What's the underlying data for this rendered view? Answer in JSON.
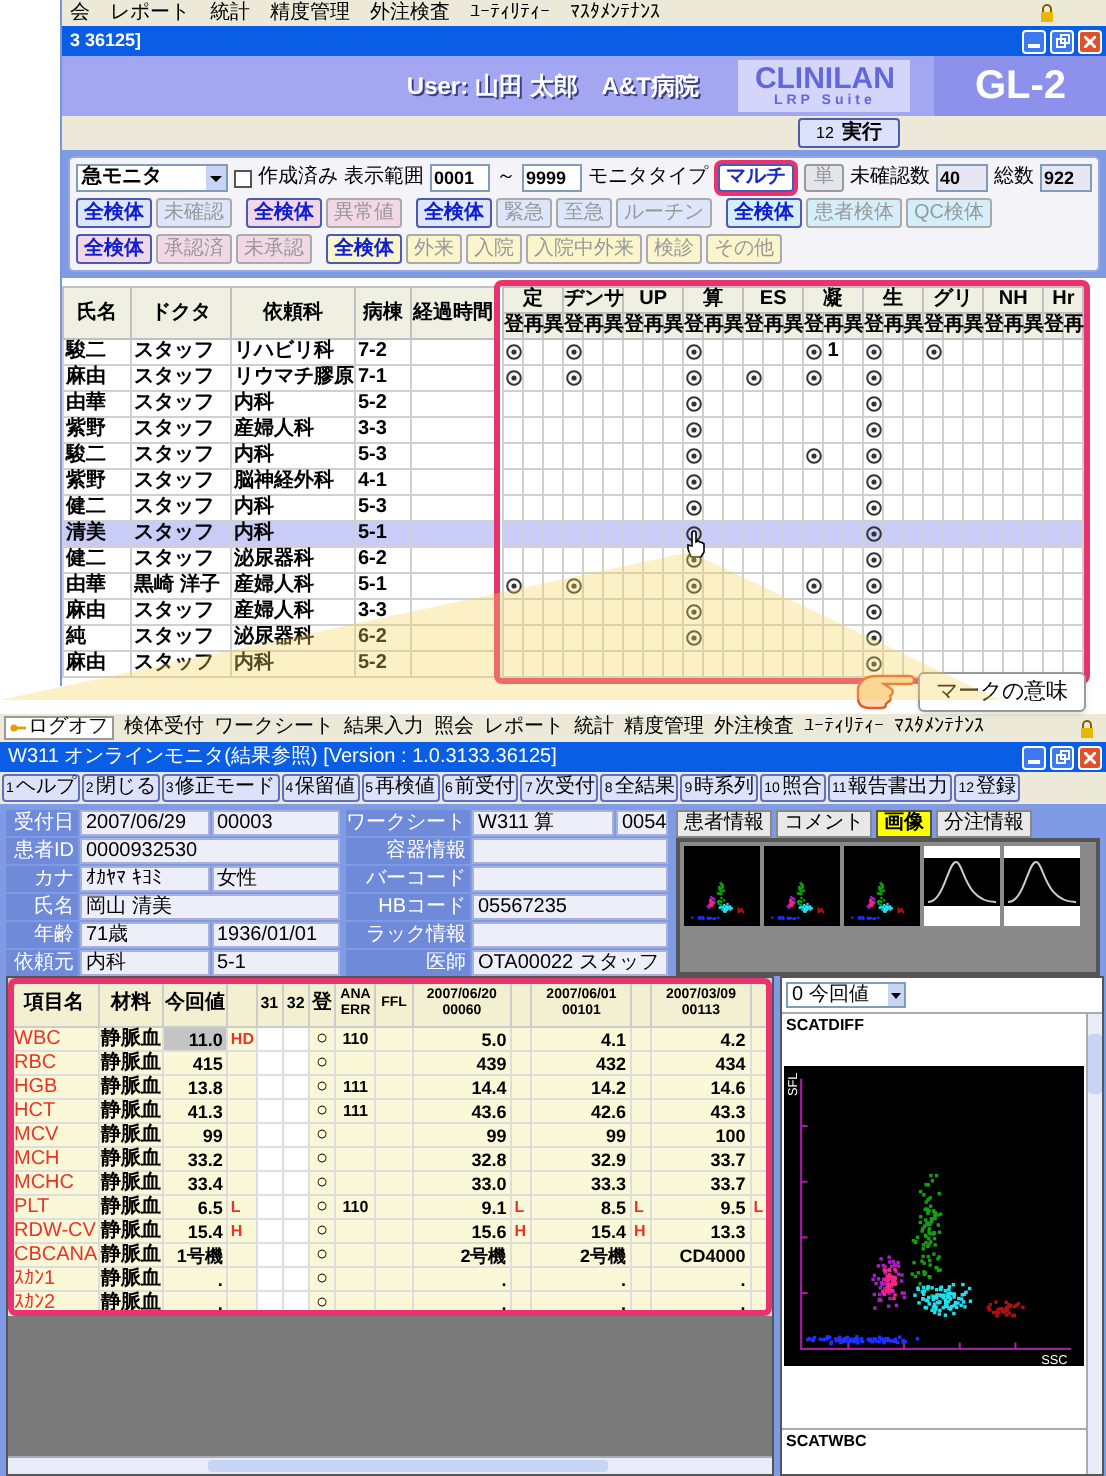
{
  "top_window": {
    "menu": [
      "会",
      "レポート",
      "統計",
      "精度管理",
      "外注検査",
      "ﾕｰﾃｨﾘﾃｨｰ",
      "ﾏｽﾀﾒﾝﾃﾅﾝｽ"
    ],
    "title": "3 36125]",
    "user": "User: 山田 太郎",
    "hospital": "A&T病院",
    "logo": "CLINILAN",
    "logo_sub": "LRP Suite",
    "product": "GL-2",
    "execute_button": {
      "key": "12",
      "label": "実行"
    },
    "filter": {
      "monitor": "急モニタ",
      "created_only": {
        "label": "作成済み",
        "checked": false
      },
      "range_label": "表示範囲",
      "range_from": "0001",
      "range_sep": "～",
      "range_to": "9999",
      "type_label": "モニタタイプ",
      "types": [
        {
          "label": "マルチ",
          "selected": true
        },
        {
          "label": "単",
          "selected": false
        }
      ],
      "unconfirmed_label": "未確認数",
      "unconfirmed": "40",
      "total_label": "総数",
      "total": "922"
    },
    "button_rows": [
      {
        "groups": [
          {
            "color": "#dde6fb",
            "buttons": [
              {
                "label": "全検体",
                "selected": true
              },
              {
                "label": "未確認",
                "selected": false
              }
            ]
          },
          {
            "color": "#f2d8e6",
            "buttons": [
              {
                "label": "全検体",
                "selected": true
              },
              {
                "label": "異常値",
                "selected": false
              }
            ]
          },
          {
            "color": "#dde6fb",
            "buttons": [
              {
                "label": "全検体",
                "selected": true
              },
              {
                "label": "緊急",
                "selected": false
              },
              {
                "label": "至急",
                "selected": false
              },
              {
                "label": "ルーチン",
                "selected": false
              }
            ]
          },
          {
            "color": "#d4eefa",
            "buttons": [
              {
                "label": "全検体",
                "selected": true
              },
              {
                "label": "患者検体",
                "selected": false
              },
              {
                "label": "QC検体",
                "selected": false
              }
            ]
          }
        ]
      },
      {
        "groups": [
          {
            "color": "#f2d8e6",
            "buttons": [
              {
                "label": "全検体",
                "selected": true
              },
              {
                "label": "承認済",
                "selected": false
              },
              {
                "label": "未承認",
                "selected": false
              }
            ]
          },
          {
            "color": "#fbf5cc",
            "buttons": [
              {
                "label": "全検体",
                "selected": true
              },
              {
                "label": "外来",
                "selected": false
              },
              {
                "label": "入院",
                "selected": false
              },
              {
                "label": "入院中外来",
                "selected": false
              },
              {
                "label": "検診",
                "selected": false
              },
              {
                "label": "その他",
                "selected": false
              }
            ]
          }
        ]
      }
    ],
    "table": {
      "columns": [
        "氏名",
        "ドクタ",
        "依頼科",
        "病棟",
        "経過時間"
      ],
      "tests": [
        {
          "name": "定",
          "slots": [
            "登",
            "再",
            "異"
          ]
        },
        {
          "name": "ヂンサ",
          "slots": [
            "登",
            "再",
            "異"
          ]
        },
        {
          "name": "UP",
          "slots": [
            "登",
            "再",
            "異"
          ]
        },
        {
          "name": "算",
          "slots": [
            "登",
            "再",
            "異"
          ]
        },
        {
          "name": "ES",
          "slots": [
            "登",
            "再",
            "異"
          ]
        },
        {
          "name": "凝",
          "slots": [
            "登",
            "再",
            "異"
          ]
        },
        {
          "name": "生",
          "slots": [
            "登",
            "再",
            "異"
          ]
        },
        {
          "name": "グリ",
          "slots": [
            "登",
            "再",
            "異"
          ]
        },
        {
          "name": "NH",
          "slots": [
            "登",
            "再",
            "異"
          ]
        },
        {
          "name": "Hr",
          "slots": [
            "登",
            "再"
          ]
        }
      ],
      "rows": [
        {
          "name": "駿二",
          "doctor": "スタッフ",
          "department": "リハビリ科",
          "ward": "7-2",
          "selected": false,
          "tests": [
            {
              "reg": true
            },
            {
              "reg": true
            },
            {
              "reg": false
            },
            {
              "reg": true
            },
            {
              "reg": false
            },
            {
              "reg": true,
              "recheck": "1"
            },
            {
              "reg": true
            },
            {
              "reg": true
            },
            {
              "reg": false
            },
            {
              "reg": false
            }
          ]
        },
        {
          "name": "麻由",
          "doctor": "スタッフ",
          "department": "リウマチ膠原",
          "ward": "7-1",
          "selected": false,
          "tests": [
            {
              "reg": true
            },
            {
              "reg": true
            },
            {
              "reg": false
            },
            {
              "reg": true
            },
            {
              "reg": true
            },
            {
              "reg": true
            },
            {
              "reg": true
            },
            {
              "reg": false
            },
            {
              "reg": false
            },
            {
              "reg": false
            }
          ]
        },
        {
          "name": "由華",
          "doctor": "スタッフ",
          "department": "内科",
          "ward": "5-2",
          "selected": false,
          "tests": [
            {
              "reg": false
            },
            {
              "reg": false
            },
            {
              "reg": false
            },
            {
              "reg": true
            },
            {
              "reg": false
            },
            {
              "reg": false
            },
            {
              "reg": true
            },
            {
              "reg": false
            },
            {
              "reg": false
            },
            {
              "reg": false
            }
          ]
        },
        {
          "name": "紫野",
          "doctor": "スタッフ",
          "department": "産婦人科",
          "ward": "3-3",
          "selected": false,
          "tests": [
            {
              "reg": false
            },
            {
              "reg": false
            },
            {
              "reg": false
            },
            {
              "reg": true
            },
            {
              "reg": false
            },
            {
              "reg": false
            },
            {
              "reg": true
            },
            {
              "reg": false
            },
            {
              "reg": false
            },
            {
              "reg": false
            }
          ]
        },
        {
          "name": "駿二",
          "doctor": "スタッフ",
          "department": "内科",
          "ward": "5-3",
          "selected": false,
          "tests": [
            {
              "reg": false
            },
            {
              "reg": false
            },
            {
              "reg": false
            },
            {
              "reg": true
            },
            {
              "reg": false
            },
            {
              "reg": true
            },
            {
              "reg": true
            },
            {
              "reg": false
            },
            {
              "reg": false
            },
            {
              "reg": false
            }
          ]
        },
        {
          "name": "紫野",
          "doctor": "スタッフ",
          "department": "脳神経外科",
          "ward": "4-1",
          "selected": false,
          "tests": [
            {
              "reg": false
            },
            {
              "reg": false
            },
            {
              "reg": false
            },
            {
              "reg": true
            },
            {
              "reg": false
            },
            {
              "reg": false
            },
            {
              "reg": true
            },
            {
              "reg": false
            },
            {
              "reg": false
            },
            {
              "reg": false
            }
          ]
        },
        {
          "name": "健二",
          "doctor": "スタッフ",
          "department": "内科",
          "ward": "5-3",
          "selected": false,
          "tests": [
            {
              "reg": false
            },
            {
              "reg": false
            },
            {
              "reg": false
            },
            {
              "reg": true
            },
            {
              "reg": false
            },
            {
              "reg": false
            },
            {
              "reg": true
            },
            {
              "reg": false
            },
            {
              "reg": false
            },
            {
              "reg": false
            }
          ]
        },
        {
          "name": "清美",
          "doctor": "スタッフ",
          "department": "内科",
          "ward": "5-1",
          "selected": true,
          "tests": [
            {
              "reg": false
            },
            {
              "reg": false
            },
            {
              "reg": false
            },
            {
              "reg": true
            },
            {
              "reg": false
            },
            {
              "reg": false
            },
            {
              "reg": true
            },
            {
              "reg": false
            },
            {
              "reg": false
            },
            {
              "reg": false
            }
          ]
        },
        {
          "name": "健二",
          "doctor": "スタッフ",
          "department": "泌尿器科",
          "ward": "6-2",
          "selected": false,
          "tests": [
            {
              "reg": false
            },
            {
              "reg": false
            },
            {
              "reg": false
            },
            {
              "reg": true
            },
            {
              "reg": false
            },
            {
              "reg": false
            },
            {
              "reg": true
            },
            {
              "reg": false
            },
            {
              "reg": false
            },
            {
              "reg": false
            }
          ]
        },
        {
          "name": "由華",
          "doctor": "黒崎 洋子",
          "department": "産婦人科",
          "ward": "5-1",
          "selected": false,
          "tests": [
            {
              "reg": true
            },
            {
              "reg": true
            },
            {
              "reg": false
            },
            {
              "reg": true
            },
            {
              "reg": false
            },
            {
              "reg": true
            },
            {
              "reg": true
            },
            {
              "reg": false
            },
            {
              "reg": false
            },
            {
              "reg": false
            }
          ]
        },
        {
          "name": "麻由",
          "doctor": "スタッフ",
          "department": "産婦人科",
          "ward": "3-3",
          "selected": false,
          "tests": [
            {
              "reg": false
            },
            {
              "reg": false
            },
            {
              "reg": false
            },
            {
              "reg": true
            },
            {
              "reg": false
            },
            {
              "reg": false
            },
            {
              "reg": true
            },
            {
              "reg": false
            },
            {
              "reg": false
            },
            {
              "reg": false
            }
          ]
        },
        {
          "name": "純",
          "doctor": "スタッフ",
          "department": "泌尿器科",
          "ward": "6-2",
          "selected": false,
          "tests": [
            {
              "reg": false
            },
            {
              "reg": false
            },
            {
              "reg": false
            },
            {
              "reg": true
            },
            {
              "reg": false
            },
            {
              "reg": false
            },
            {
              "reg": true
            },
            {
              "reg": false
            },
            {
              "reg": false
            },
            {
              "reg": false
            }
          ]
        },
        {
          "name": "麻由",
          "doctor": "スタッフ",
          "department": "内科",
          "ward": "5-2",
          "selected": false,
          "tests": [
            {
              "reg": false
            },
            {
              "reg": false
            },
            {
              "reg": false
            },
            {
              "reg": false
            },
            {
              "reg": false
            },
            {
              "reg": false
            },
            {
              "reg": true
            },
            {
              "reg": false
            },
            {
              "reg": false
            },
            {
              "reg": false
            }
          ]
        }
      ]
    },
    "callout": "マークの意味"
  },
  "detail_window": {
    "logoff": "ログオフ",
    "menu": [
      "検体受付",
      "ワークシート",
      "結果入力",
      "照会",
      "レポート",
      "統計",
      "精度管理",
      "外注検査",
      "ﾕｰﾃｨﾘﾃｨｰ",
      "ﾏｽﾀﾒﾝﾃﾅﾝｽ"
    ],
    "title": "W311 オンラインモニタ(結果参照) [Version : 1.0.3133.36125]",
    "function_keys": [
      {
        "key": "1",
        "label": "ヘルプ"
      },
      {
        "key": "2",
        "label": "閉じる"
      },
      {
        "key": "3",
        "label": "修正モード"
      },
      {
        "key": "4",
        "label": "保留値"
      },
      {
        "key": "5",
        "label": "再検値"
      },
      {
        "key": "6",
        "label": "前受付"
      },
      {
        "key": "7",
        "label": "次受付"
      },
      {
        "key": "8",
        "label": "全結果"
      },
      {
        "key": "9",
        "label": "時系列"
      },
      {
        "key": "10",
        "label": "照合"
      },
      {
        "key": "11",
        "label": "報告書出力"
      },
      {
        "key": "12",
        "label": "登録"
      }
    ],
    "patient": [
      {
        "label": "受付日",
        "values": [
          "2007/06/29",
          "00003"
        ]
      },
      {
        "label": "患者ID",
        "values": [
          "0000932530"
        ]
      },
      {
        "label": "カナ",
        "values": [
          "ｵｶﾔﾏ ｷﾖﾐ",
          "女性"
        ]
      },
      {
        "label": "氏名",
        "values": [
          "岡山 清美"
        ]
      },
      {
        "label": "年齢",
        "values": [
          "71歳",
          "1936/01/01"
        ]
      },
      {
        "label": "依頼元",
        "values": [
          "内科",
          "5-1"
        ]
      }
    ],
    "sample": [
      {
        "label": "ワークシート",
        "values": [
          "W311 算",
          "0054"
        ]
      },
      {
        "label": "容器情報"
      },
      {
        "label": "バーコード"
      },
      {
        "label": "HBコード",
        "values": [
          "05567235"
        ]
      },
      {
        "label": "ラック情報"
      },
      {
        "label": "医師",
        "values": [
          "OTA00022 スタッフ"
        ]
      }
    ],
    "tabs": [
      {
        "label": "患者情報",
        "selected": false
      },
      {
        "label": "コメント",
        "selected": false
      },
      {
        "label": "画像",
        "selected": true
      },
      {
        "label": "分注情報",
        "selected": false
      }
    ],
    "thumbnails": [
      {
        "kind": "scatter"
      },
      {
        "kind": "scatter"
      },
      {
        "kind": "scatter"
      },
      {
        "kind": "histogram"
      },
      {
        "kind": "histogram"
      }
    ],
    "history_select": "0 今回値",
    "plot": {
      "title": "SCATDIFF",
      "ylabel": "SFL",
      "xlabel": "SSC"
    },
    "next_plot_title": "SCATWBC",
    "results": {
      "headers": {
        "item": "項目名",
        "material": "材料",
        "current": "今回値",
        "c31": "31",
        "c32": "32",
        "reg": "登",
        "ana": "ANA ERR",
        "ffl": "FFL",
        "history": [
          "2007/06/20 00060",
          "2007/06/01 00101",
          "2007/03/09 00113"
        ]
      },
      "rows": [
        {
          "item": "WBC",
          "material": "静脈血",
          "current": "11.0",
          "flag": "HD",
          "selected": true,
          "reg": "○",
          "ana": "110",
          "history": [
            {
              "value": "5.0"
            },
            {
              "value": "4.1"
            },
            {
              "value": "4.2"
            }
          ]
        },
        {
          "item": "RBC",
          "material": "静脈血",
          "current": "415",
          "selected": false,
          "reg": "○",
          "history": [
            {
              "value": "439"
            },
            {
              "value": "432"
            },
            {
              "value": "434"
            }
          ]
        },
        {
          "item": "HGB",
          "material": "静脈血",
          "current": "13.8",
          "selected": false,
          "reg": "○",
          "ana": "111",
          "history": [
            {
              "value": "14.4"
            },
            {
              "value": "14.2"
            },
            {
              "value": "14.6"
            }
          ]
        },
        {
          "item": "HCT",
          "material": "静脈血",
          "current": "41.3",
          "selected": false,
          "reg": "○",
          "ana": "111",
          "history": [
            {
              "value": "43.6"
            },
            {
              "value": "42.6"
            },
            {
              "value": "43.3"
            }
          ]
        },
        {
          "item": "MCV",
          "material": "静脈血",
          "current": "99",
          "selected": false,
          "reg": "○",
          "history": [
            {
              "value": "99"
            },
            {
              "value": "99"
            },
            {
              "value": "100"
            }
          ]
        },
        {
          "item": "MCH",
          "material": "静脈血",
          "current": "33.2",
          "selected": false,
          "reg": "○",
          "history": [
            {
              "value": "32.8"
            },
            {
              "value": "32.9"
            },
            {
              "value": "33.7"
            }
          ]
        },
        {
          "item": "MCHC",
          "material": "静脈血",
          "current": "33.4",
          "selected": false,
          "reg": "○",
          "history": [
            {
              "value": "33.0"
            },
            {
              "value": "33.3"
            },
            {
              "value": "33.7"
            }
          ]
        },
        {
          "item": "PLT",
          "material": "静脈血",
          "current": "6.5",
          "flag": "L",
          "selected": false,
          "reg": "○",
          "ana": "110",
          "history": [
            {
              "value": "9.1",
              "flag": "L"
            },
            {
              "value": "8.5",
              "flag": "L"
            },
            {
              "value": "9.5",
              "flag": "L"
            }
          ]
        },
        {
          "item": "RDW-CV",
          "material": "静脈血",
          "current": "15.4",
          "flag": "H",
          "selected": false,
          "reg": "○",
          "history": [
            {
              "value": "15.6",
              "flag": "H"
            },
            {
              "value": "15.4",
              "flag": "H"
            },
            {
              "value": "13.3"
            }
          ]
        },
        {
          "item": "CBCANA",
          "material": "静脈血",
          "current": "1号機",
          "selected": false,
          "reg": "○",
          "history": [
            {
              "value": "2号機"
            },
            {
              "value": "2号機"
            },
            {
              "value": "CD4000"
            }
          ]
        },
        {
          "item": "ｽｶﾝ1",
          "material": "静脈血",
          "current": ".",
          "selected": false,
          "reg": "○",
          "history": [
            {
              "value": "."
            },
            {
              "value": "."
            },
            {
              "value": "."
            }
          ]
        },
        {
          "item": "ｽｶﾝ2",
          "material": "静脈血",
          "current": ".",
          "selected": false,
          "reg": "○",
          "history": [
            {
              "value": "."
            },
            {
              "value": "."
            },
            {
              "value": "."
            }
          ]
        }
      ]
    }
  }
}
